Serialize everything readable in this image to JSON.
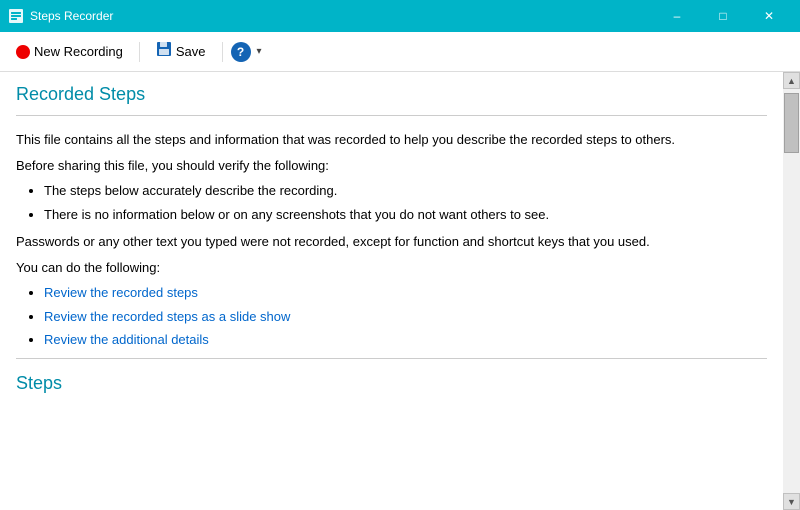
{
  "titlebar": {
    "icon": "steps-recorder-icon",
    "title": "Steps Recorder",
    "minimize_label": "–",
    "maximize_label": "□",
    "close_label": "✕"
  },
  "toolbar": {
    "new_recording_label": "New Recording",
    "save_label": "Save",
    "help_label": "?",
    "dropdown_label": "▾"
  },
  "content": {
    "recorded_steps_title": "Recorded Steps",
    "intro_paragraph1": "This file contains all the steps and information that was recorded to help you describe the recorded steps to others.",
    "intro_paragraph2": "Before sharing this file, you should verify the following:",
    "bullet1": "The steps below accurately describe the recording.",
    "bullet2": "There is no information below or on any screenshots that you do not want others to see.",
    "intro_paragraph3": "Passwords or any other text you typed were not recorded, except for function and shortcut keys that you used.",
    "intro_paragraph4": "You can do the following:",
    "link1": "Review the recorded steps",
    "link2": "Review the recorded steps as a slide show",
    "link3": "Review the additional details",
    "steps_title": "Steps"
  }
}
